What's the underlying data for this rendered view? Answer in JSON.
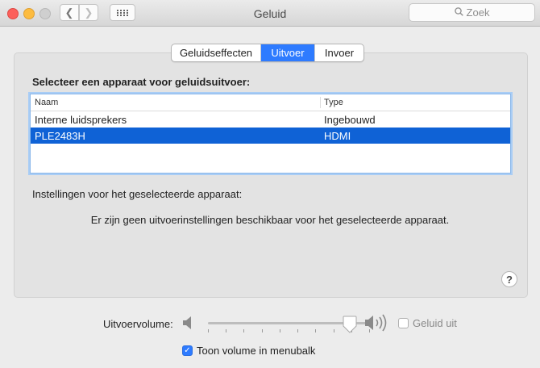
{
  "window": {
    "title": "Geluid",
    "search_placeholder": "Zoek"
  },
  "tabs": [
    {
      "label": "Geluidseffecten",
      "active": false
    },
    {
      "label": "Uitvoer",
      "active": true
    },
    {
      "label": "Invoer",
      "active": false
    }
  ],
  "output": {
    "heading": "Selecteer een apparaat voor geluidsuitvoer:",
    "columns": [
      "Naam",
      "Type"
    ],
    "devices": [
      {
        "name": "Interne luidsprekers",
        "type": "Ingebouwd",
        "selected": false
      },
      {
        "name": "PLE2483H",
        "type": "HDMI",
        "selected": true
      }
    ],
    "settings_label": "Instellingen voor het geselecteerde apparaat:",
    "no_settings_text": "Er zijn geen uitvoerinstellingen beschikbaar voor het geselecteerde apparaat."
  },
  "help": {
    "glyph": "?"
  },
  "volume": {
    "label": "Uitvoervolume:",
    "level_fraction": 0.88,
    "mute_label": "Geluid uit",
    "muted": false,
    "menubar_label": "Toon volume in menubalk",
    "show_in_menubar": true
  },
  "colors": {
    "accent": "#2e7bff",
    "selection": "#0f62d6"
  },
  "icons": [
    "back-chevron-icon",
    "forward-chevron-icon",
    "grid-icon",
    "search-icon",
    "speaker-low-icon",
    "speaker-high-icon",
    "checkmark-icon"
  ]
}
